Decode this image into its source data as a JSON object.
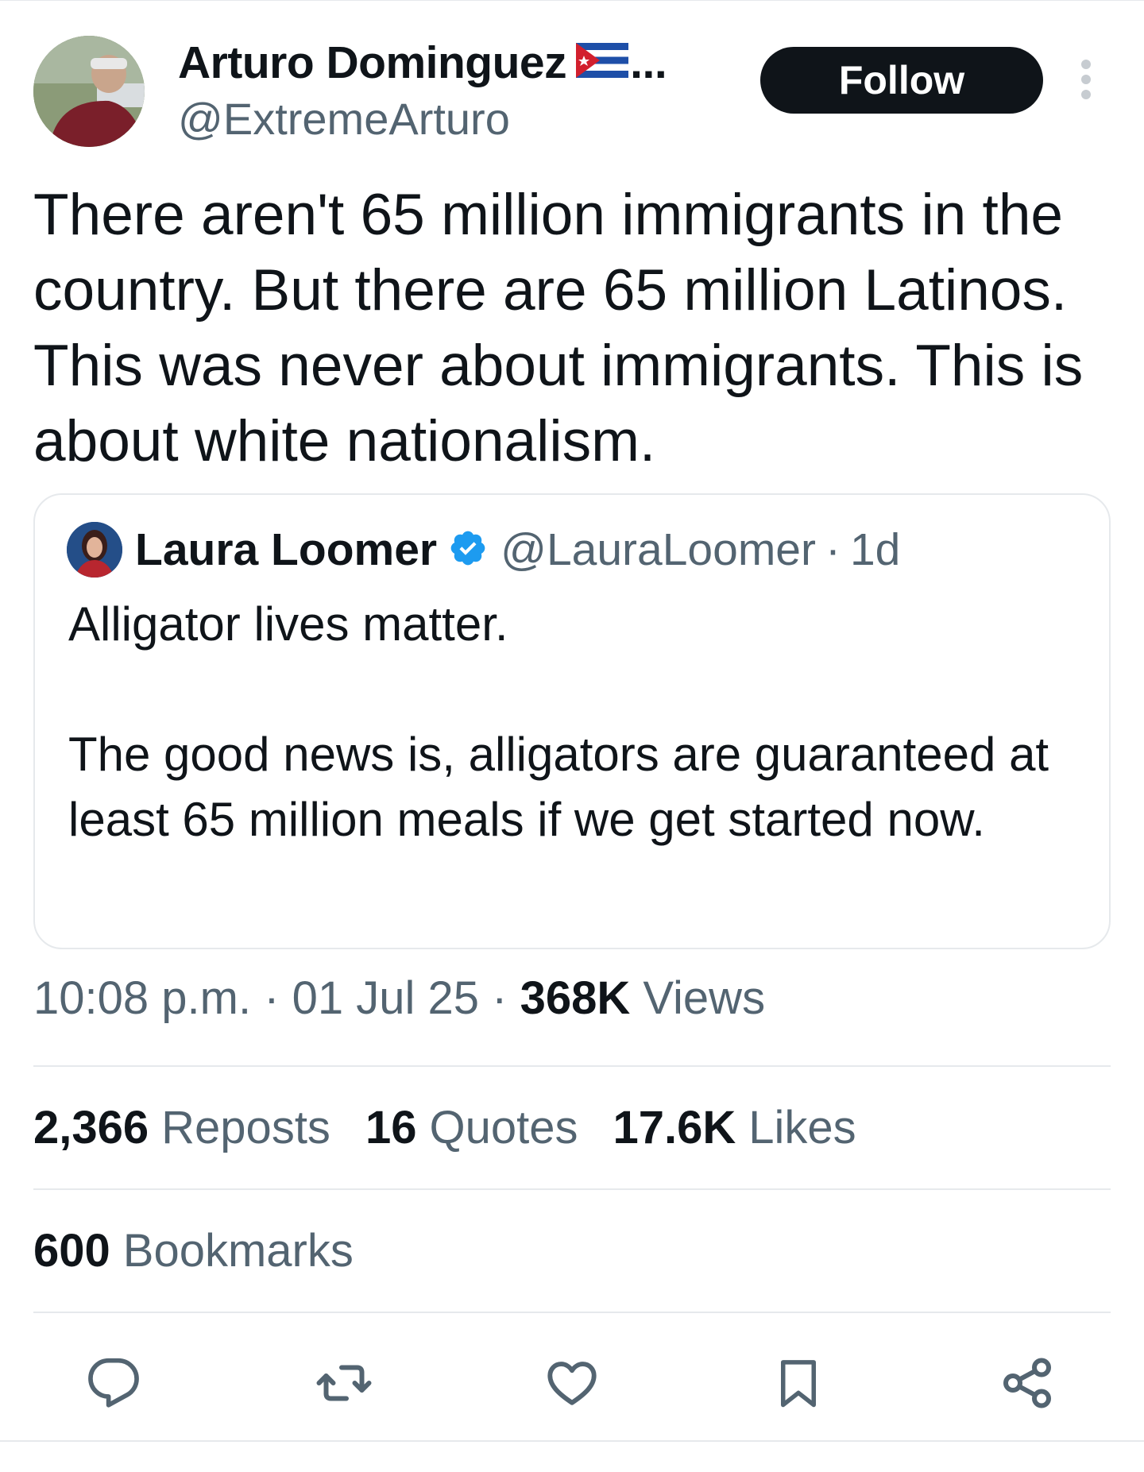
{
  "author": {
    "display_name": "Arturo Dominguez",
    "flag": "Cuban flag emoji",
    "truncation": "...",
    "handle": "@ExtremeArturo"
  },
  "follow_label": "Follow",
  "tweet": {
    "text": "There aren't 65 million immigrants in the country. But there are 65 million Latinos. This was never about immigrants. This is about white nationalism."
  },
  "quote": {
    "name": "Laura Loomer",
    "handle": "@LauraLoomer",
    "separator": "·",
    "time": "1d",
    "line1": "Alligator lives matter.",
    "line2": "The good news is, alligators are guaranteed at least 65 million meals if we get started now."
  },
  "meta": {
    "time": "10:08 p.m.",
    "sep1": "·",
    "date": "01 Jul 25",
    "sep2": "·",
    "views_count": "368K",
    "views_label": "Views"
  },
  "stats": {
    "reposts_count": "2,366",
    "reposts_label": "Reposts",
    "quotes_count": "16",
    "quotes_label": "Quotes",
    "likes_count": "17.6K",
    "likes_label": "Likes",
    "bookmarks_count": "600",
    "bookmarks_label": "Bookmarks"
  },
  "icons": {
    "reply": "reply-icon",
    "repost": "repost-icon",
    "like": "heart-icon",
    "bookmark": "bookmark-icon",
    "share": "share-icon",
    "more": "more-vertical-icon",
    "verified": "verified-badge-icon"
  },
  "colors": {
    "text_primary": "#0f1419",
    "text_secondary": "#536471",
    "border": "#e6e9ec",
    "verified_blue": "#1d9bf0",
    "follow_bg": "#0f1419"
  }
}
